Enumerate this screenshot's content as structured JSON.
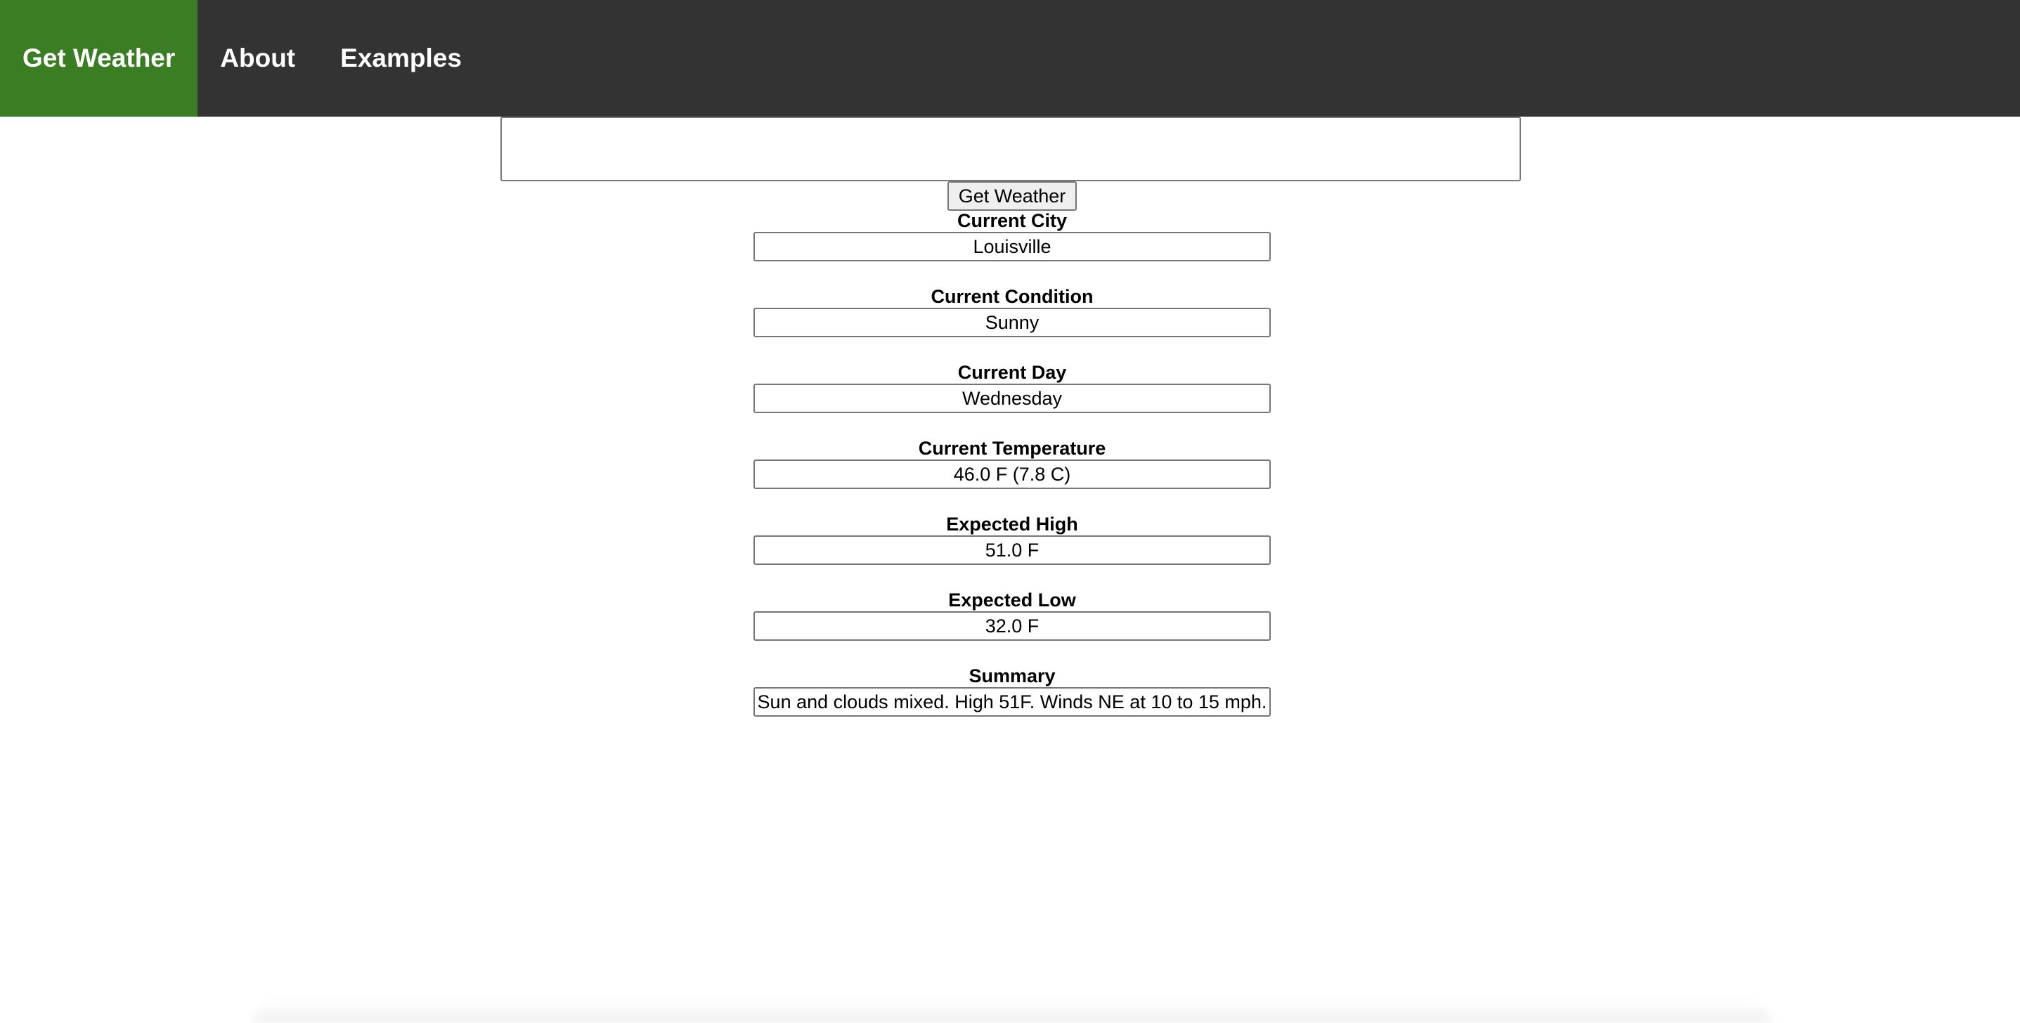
{
  "nav": {
    "items": [
      {
        "label": "Get Weather",
        "active": true
      },
      {
        "label": "About",
        "active": false
      },
      {
        "label": "Examples",
        "active": false
      }
    ]
  },
  "search": {
    "value": "",
    "placeholder": "",
    "button_label": "Get Weather"
  },
  "fields": [
    {
      "label": "Current City",
      "value": "Louisville"
    },
    {
      "label": "Current Condition",
      "value": "Sunny"
    },
    {
      "label": "Current Day",
      "value": "Wednesday"
    },
    {
      "label": "Current Temperature",
      "value": "46.0 F (7.8 C)"
    },
    {
      "label": "Expected High",
      "value": "51.0 F"
    },
    {
      "label": "Expected Low",
      "value": "32.0 F"
    },
    {
      "label": "Summary",
      "value": "Sun and clouds mixed. High 51F. Winds NE at 10 to 15 mph."
    }
  ],
  "colors": {
    "nav_background": "#333333",
    "nav_active": "#3a7d22",
    "nav_text": "#ffffff"
  }
}
